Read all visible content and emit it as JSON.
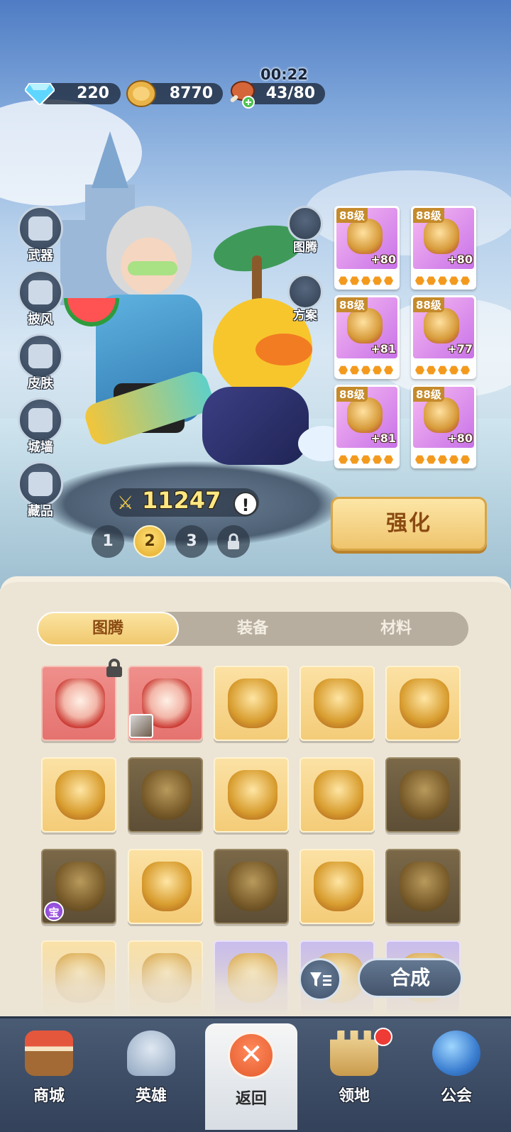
{
  "resources": {
    "diamond": "220",
    "gold": "8770",
    "stamina": "43/80",
    "stamina_timer": "00:22"
  },
  "side_menu": [
    {
      "label": "武器",
      "icon": "weapon-icon"
    },
    {
      "label": "披风",
      "icon": "cape-icon"
    },
    {
      "label": "皮肤",
      "icon": "skin-icon"
    },
    {
      "label": "城墙",
      "icon": "wall-icon"
    },
    {
      "label": "藏品",
      "icon": "collection-icon"
    }
  ],
  "tools": [
    {
      "label": "图腾",
      "icon": "totem-icon"
    },
    {
      "label": "方案",
      "icon": "preset-icon"
    }
  ],
  "equipment": [
    {
      "level": "88级",
      "bonus": "+80",
      "stars": 5
    },
    {
      "level": "88级",
      "bonus": "+80",
      "stars": 5
    },
    {
      "level": "88级",
      "bonus": "+81",
      "stars": 5
    },
    {
      "level": "88级",
      "bonus": "+77",
      "stars": 5
    },
    {
      "level": "88级",
      "bonus": "+81",
      "stars": 5
    },
    {
      "level": "88级",
      "bonus": "+80",
      "stars": 5
    }
  ],
  "power": "11247",
  "alert_glyph": "!",
  "pages": [
    "1",
    "2",
    "3"
  ],
  "current_page": "2",
  "strengthen_label": "强化",
  "tabs": [
    {
      "label": "图腾",
      "active": true
    },
    {
      "label": "装备",
      "active": false
    },
    {
      "label": "材料",
      "active": false
    }
  ],
  "treasure_badge": "宝",
  "synthesize_label": "合成",
  "nav": [
    {
      "label": "商城",
      "icon": "shop-icon"
    },
    {
      "label": "英雄",
      "icon": "hero-helmet-icon"
    },
    {
      "label": "返回",
      "icon": "close-icon",
      "active": true
    },
    {
      "label": "领地",
      "icon": "castle-icon",
      "badge": true
    },
    {
      "label": "公会",
      "icon": "planet-icon"
    }
  ],
  "colors": {
    "accent_gold": "#f0c86e",
    "panel_bg": "#ece5d6",
    "nav_bg": "#3b4a62",
    "badge_red": "#ee3b35"
  }
}
